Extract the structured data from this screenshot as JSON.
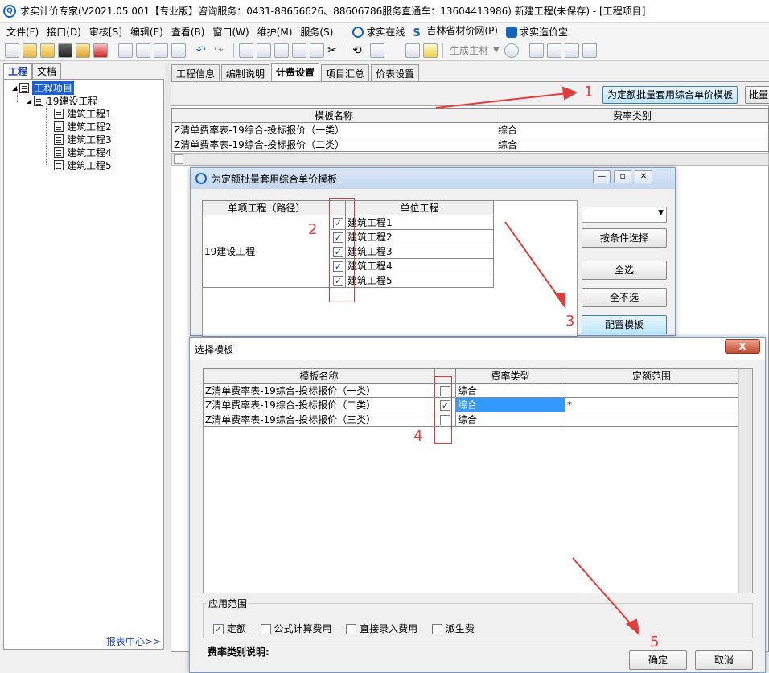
{
  "window": {
    "title": "求实计价专家(V2021.05.001【专业版】咨询服务：0431-88656626、88606786服务直通车：13604413986) 新建工程(未保存) - [工程项目]"
  },
  "menu": {
    "items": [
      "文件(F)",
      "接口(D)",
      "审核[S]",
      "编辑(E)",
      "查看(B)",
      "窗口(W)",
      "维护(M)",
      "服务(S)"
    ],
    "links": [
      "求实在线",
      "吉林省材价网(P)",
      "求实造价宝"
    ]
  },
  "toolbar": {
    "material_label": "生成主材"
  },
  "left": {
    "tabs": [
      "工程",
      "文档"
    ],
    "tree": {
      "root": "工程项目",
      "project": "19建设工程",
      "units": [
        "建筑工程1",
        "建筑工程2",
        "建筑工程3",
        "建筑工程4",
        "建筑工程5"
      ]
    },
    "report_link": "报表中心>>"
  },
  "right": {
    "tabs": [
      "工程信息",
      "编制说明",
      "计费设置",
      "项目汇总",
      "价表设置"
    ],
    "active_tab": "计费设置",
    "batch_button": "为定额批量套用综合单价模板",
    "batch_button2": "批量",
    "table": {
      "headers": [
        "模板名称",
        "费率类别"
      ],
      "rows": [
        [
          "Z清单费率表-19综合-投标报价（一类）",
          "综合"
        ],
        [
          "Z清单费率表-19综合-投标报价（二类）",
          "综合"
        ]
      ]
    }
  },
  "dialog1": {
    "title": "为定额批量套用综合单价模板",
    "headers": [
      "单项工程（路径）",
      "单位工程"
    ],
    "project": "19建设工程",
    "units": [
      "建筑工程1",
      "建筑工程2",
      "建筑工程3",
      "建筑工程4",
      "建筑工程5"
    ],
    "buttons": {
      "by_condition": "按条件选择",
      "select_all": "全选",
      "select_none": "全不选",
      "config": "配置模板"
    }
  },
  "dialog2": {
    "title": "选择模板",
    "headers": [
      "模板名称",
      "费率类型",
      "定额范围"
    ],
    "rows": [
      {
        "name": "Z清单费率表-19综合-投标报价（一类）",
        "checked": false,
        "type": "综合",
        "range": ""
      },
      {
        "name": "Z清单费率表-19综合-投标报价（二类）",
        "checked": true,
        "type": "综合",
        "range": "*"
      },
      {
        "name": "Z清单费率表-19综合-投标报价（三类）",
        "checked": false,
        "type": "综合",
        "range": ""
      }
    ],
    "scope_label": "应用范围",
    "scope": [
      {
        "label": "定额",
        "checked": true
      },
      {
        "label": "公式计算费用",
        "checked": false
      },
      {
        "label": "直接录入费用",
        "checked": false
      },
      {
        "label": "派生费",
        "checked": false
      }
    ],
    "desc_label": "费率类别说明:",
    "ok": "确定",
    "cancel": "取消",
    "close": "X"
  },
  "annotations": {
    "n1": "1",
    "n2": "2",
    "n3": "3",
    "n4": "4",
    "n5": "5"
  },
  "colors": {
    "annotation": "#e23c3c",
    "selection": "#1a5fd6",
    "link": "#1a3fb5"
  }
}
